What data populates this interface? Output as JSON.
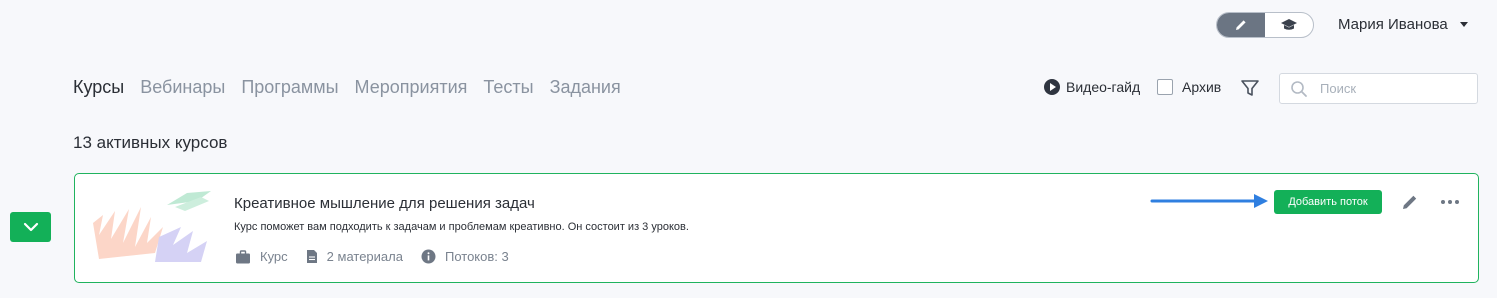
{
  "header": {
    "mode_toggle": {
      "left_icon": "pencil-icon",
      "right_icon": "graduation-cap-icon",
      "active": "left"
    },
    "user_name": "Мария Иванова"
  },
  "tabs": [
    {
      "label": "Курсы",
      "active": true
    },
    {
      "label": "Вебинары",
      "active": false
    },
    {
      "label": "Программы",
      "active": false
    },
    {
      "label": "Мероприятия",
      "active": false
    },
    {
      "label": "Тесты",
      "active": false
    },
    {
      "label": "Задания",
      "active": false
    }
  ],
  "toolbar": {
    "video_guide_label": "Видео-гайд",
    "archive_label": "Архив",
    "archive_checked": false,
    "search_placeholder": "Поиск"
  },
  "summary": {
    "count_label": "13 активных курсов"
  },
  "course": {
    "title": "Креативное мышление для решения задач",
    "description": "Курс поможет вам подходить к задачам и проблемам креативно. Он состоит из 3 уроков.",
    "meta": {
      "type_label": "Курс",
      "materials_label": "2 материала",
      "streams_label": "Потоков: 3"
    },
    "add_stream_label": "Добавить поток"
  },
  "colors": {
    "accent_green": "#13b058",
    "card_border": "#20b35e",
    "annotation_arrow": "#2f7fe0"
  }
}
